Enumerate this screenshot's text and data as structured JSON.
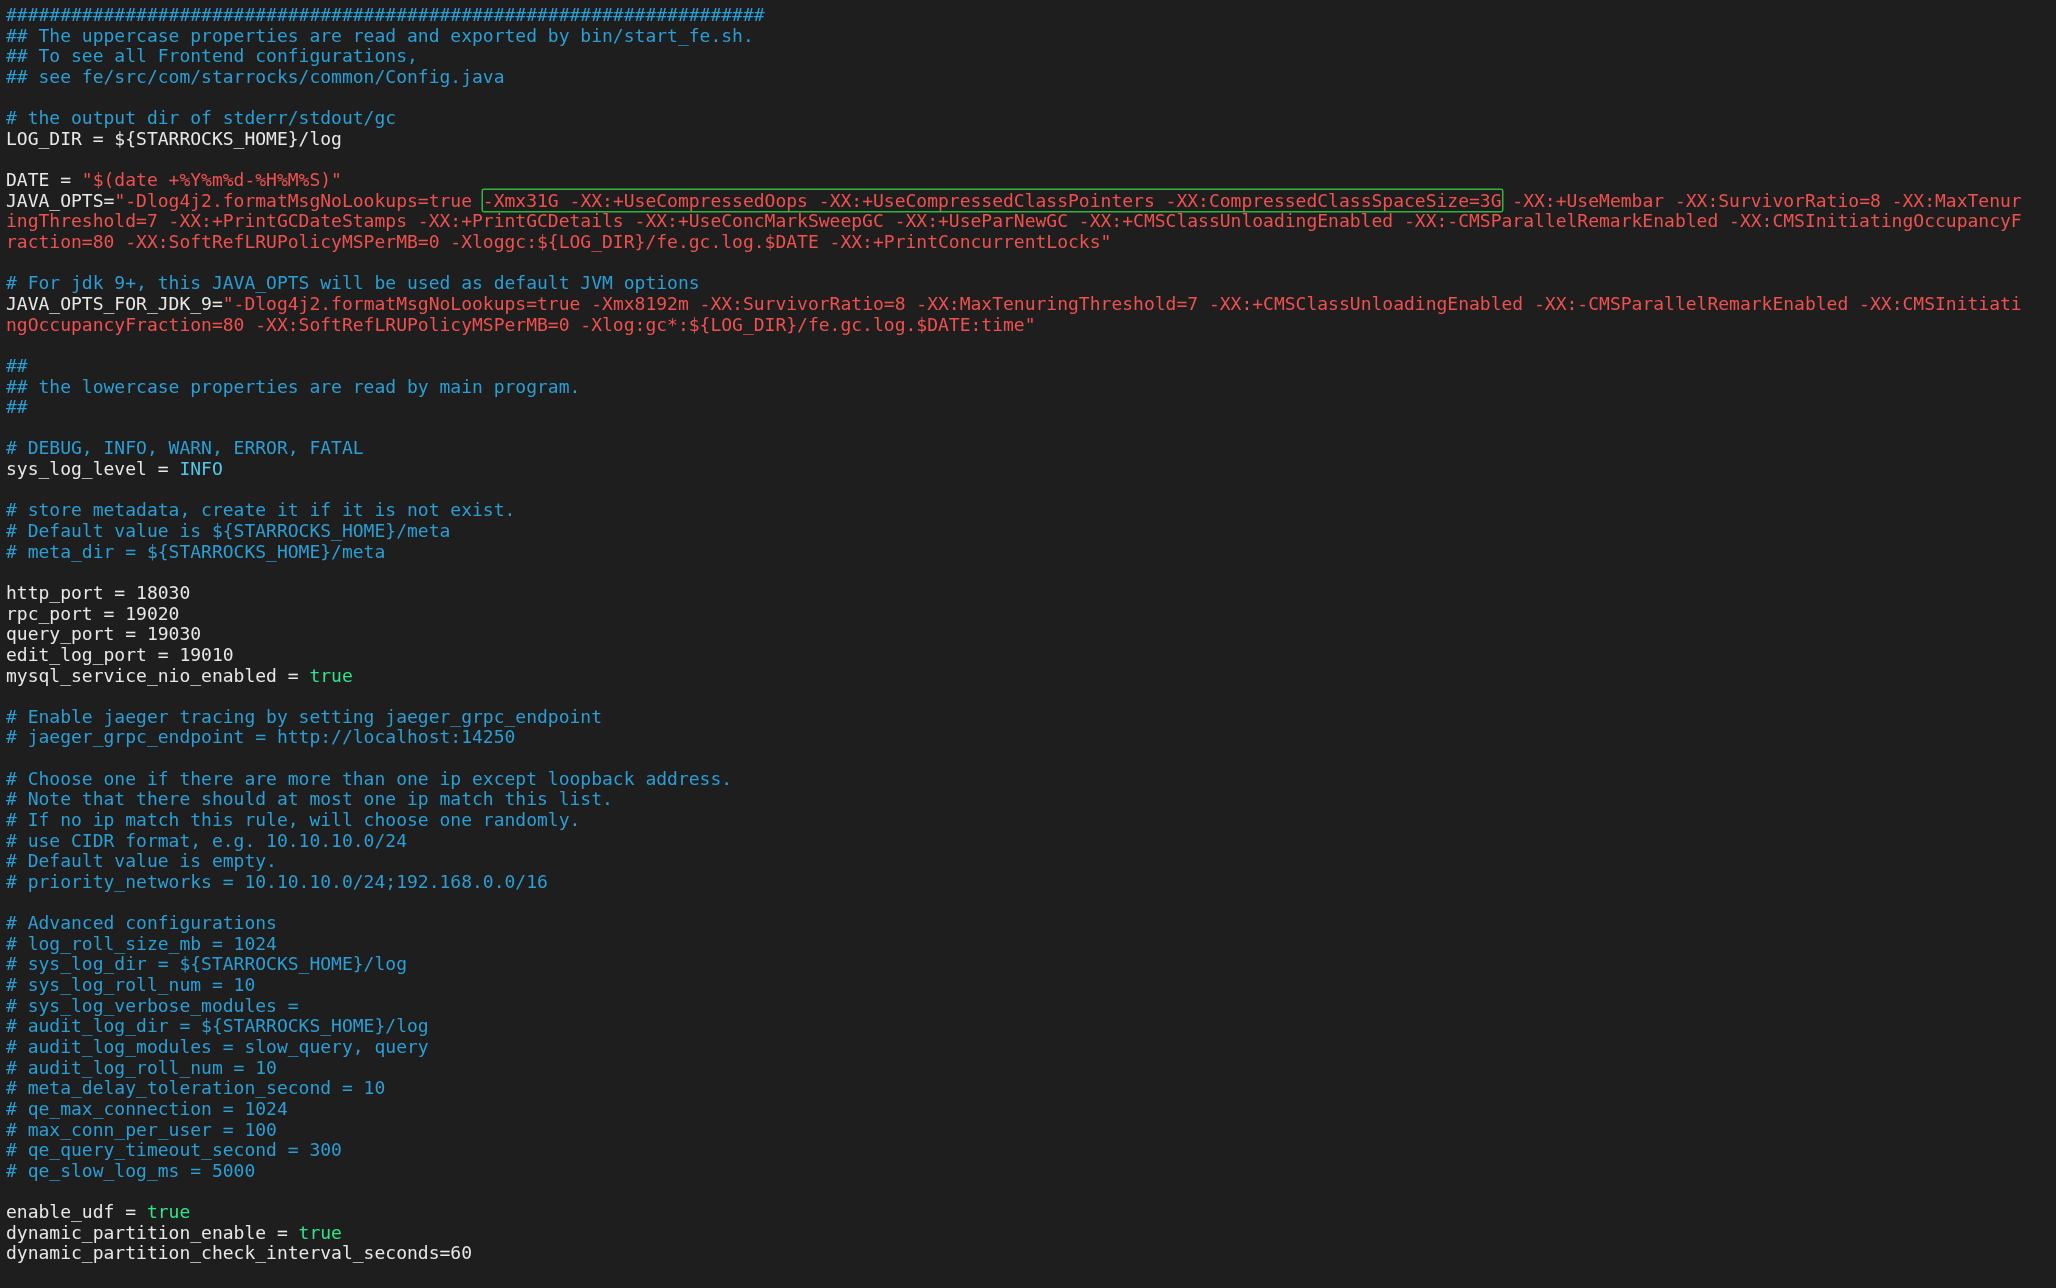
{
  "editor": {
    "lines": [
      {
        "kind": "text",
        "segments": [
          {
            "kind": "comment",
            "text": "######################################################################"
          }
        ]
      },
      {
        "kind": "text",
        "segments": [
          {
            "kind": "comment",
            "text": "## The uppercase properties are read and exported by bin/start_fe.sh."
          }
        ]
      },
      {
        "kind": "text",
        "segments": [
          {
            "kind": "comment",
            "text": "## To see all Frontend configurations,"
          }
        ]
      },
      {
        "kind": "text",
        "segments": [
          {
            "kind": "comment",
            "text": "## see fe/src/com/starrocks/common/Config.java"
          }
        ]
      },
      {
        "kind": "blank"
      },
      {
        "kind": "text",
        "segments": [
          {
            "kind": "comment",
            "text": "# the output dir of stderr/stdout/gc"
          }
        ]
      },
      {
        "kind": "text",
        "segments": [
          {
            "kind": "plain",
            "text": "LOG_DIR = ${STARROCKS_HOME}/log"
          }
        ]
      },
      {
        "kind": "blank"
      },
      {
        "kind": "text",
        "segments": [
          {
            "kind": "plain",
            "text": "DATE = "
          },
          {
            "kind": "string",
            "text": "\"$(date +%Y%m%d-%H%M%S)\""
          }
        ]
      },
      {
        "kind": "text",
        "segments": [
          {
            "kind": "plain",
            "text": "JAVA_OPTS="
          },
          {
            "kind": "string",
            "text": "\"-Dlog4j2.formatMsgNoLookups=true "
          },
          {
            "kind": "string",
            "boxed": true,
            "text": "-Xmx31G -XX:+UseCompressedOops -XX:+UseCompressedClassPointers -XX:CompressedClassSpaceSize=3G"
          },
          {
            "kind": "string",
            "text": " -XX:+UseMembar -XX:SurvivorRatio=8 -XX:MaxTenur"
          }
        ]
      },
      {
        "kind": "text",
        "segments": [
          {
            "kind": "string",
            "text": "ingThreshold=7 -XX:+PrintGCDateStamps -XX:+PrintGCDetails -XX:+UseConcMarkSweepGC -XX:+UseParNewGC -XX:+CMSClassUnloadingEnabled -XX:-CMSParallelRemarkEnabled -XX:CMSInitiatingOccupancyF"
          }
        ]
      },
      {
        "kind": "text",
        "segments": [
          {
            "kind": "string",
            "text": "raction=80 -XX:SoftRefLRUPolicyMSPerMB=0 -Xloggc:${LOG_DIR}/fe.gc.log.$DATE -XX:+PrintConcurrentLocks\""
          }
        ]
      },
      {
        "kind": "blank"
      },
      {
        "kind": "text",
        "segments": [
          {
            "kind": "comment",
            "text": "# For jdk 9+, this JAVA_OPTS will be used as default JVM options"
          }
        ]
      },
      {
        "kind": "text",
        "segments": [
          {
            "kind": "plain",
            "text": "JAVA_OPTS_FOR_JDK_9="
          },
          {
            "kind": "string",
            "text": "\"-Dlog4j2.formatMsgNoLookups=true -Xmx8192m -XX:SurvivorRatio=8 -XX:MaxTenuringThreshold=7 -XX:+CMSClassUnloadingEnabled -XX:-CMSParallelRemarkEnabled -XX:CMSInitiati"
          }
        ]
      },
      {
        "kind": "text",
        "segments": [
          {
            "kind": "string",
            "text": "ngOccupancyFraction=80 -XX:SoftRefLRUPolicyMSPerMB=0 -Xlog:gc*:${LOG_DIR}/fe.gc.log.$DATE:time\""
          }
        ]
      },
      {
        "kind": "blank"
      },
      {
        "kind": "text",
        "segments": [
          {
            "kind": "comment",
            "text": "##"
          }
        ]
      },
      {
        "kind": "text",
        "segments": [
          {
            "kind": "comment",
            "text": "## the lowercase properties are read by main program."
          }
        ]
      },
      {
        "kind": "text",
        "segments": [
          {
            "kind": "comment",
            "text": "##"
          }
        ]
      },
      {
        "kind": "blank"
      },
      {
        "kind": "text",
        "segments": [
          {
            "kind": "comment",
            "text": "# DEBUG, INFO, WARN, ERROR, FATAL"
          }
        ]
      },
      {
        "kind": "text",
        "segments": [
          {
            "kind": "plain",
            "text": "sys_log_level = "
          },
          {
            "kind": "constant",
            "text": "INFO"
          }
        ]
      },
      {
        "kind": "blank"
      },
      {
        "kind": "text",
        "segments": [
          {
            "kind": "comment",
            "text": "# store metadata, create it if it is not exist."
          }
        ]
      },
      {
        "kind": "text",
        "segments": [
          {
            "kind": "comment",
            "text": "# Default value is ${STARROCKS_HOME}/meta"
          }
        ]
      },
      {
        "kind": "text",
        "segments": [
          {
            "kind": "comment",
            "text": "# meta_dir = ${STARROCKS_HOME}/meta"
          }
        ]
      },
      {
        "kind": "blank"
      },
      {
        "kind": "text",
        "segments": [
          {
            "kind": "plain",
            "text": "http_port = 18030"
          }
        ]
      },
      {
        "kind": "text",
        "segments": [
          {
            "kind": "plain",
            "text": "rpc_port = 19020"
          }
        ]
      },
      {
        "kind": "text",
        "segments": [
          {
            "kind": "plain",
            "text": "query_port = 19030"
          }
        ]
      },
      {
        "kind": "text",
        "segments": [
          {
            "kind": "plain",
            "text": "edit_log_port = 19010"
          }
        ]
      },
      {
        "kind": "text",
        "segments": [
          {
            "kind": "plain",
            "text": "mysql_service_nio_enabled = "
          },
          {
            "kind": "boolean",
            "text": "true"
          }
        ]
      },
      {
        "kind": "blank"
      },
      {
        "kind": "text",
        "segments": [
          {
            "kind": "comment",
            "text": "# Enable jaeger tracing by setting jaeger_grpc_endpoint"
          }
        ]
      },
      {
        "kind": "text",
        "segments": [
          {
            "kind": "comment",
            "text": "# jaeger_grpc_endpoint = http://localhost:14250"
          }
        ]
      },
      {
        "kind": "blank"
      },
      {
        "kind": "text",
        "segments": [
          {
            "kind": "comment",
            "text": "# Choose one if there are more than one ip except loopback address."
          }
        ]
      },
      {
        "kind": "text",
        "segments": [
          {
            "kind": "comment",
            "text": "# Note that there should at most one ip match this list."
          }
        ]
      },
      {
        "kind": "text",
        "segments": [
          {
            "kind": "comment",
            "text": "# If no ip match this rule, will choose one randomly."
          }
        ]
      },
      {
        "kind": "text",
        "segments": [
          {
            "kind": "comment",
            "text": "# use CIDR format, e.g. 10.10.10.0/24"
          }
        ]
      },
      {
        "kind": "text",
        "segments": [
          {
            "kind": "comment",
            "text": "# Default value is empty."
          }
        ]
      },
      {
        "kind": "text",
        "segments": [
          {
            "kind": "comment",
            "text": "# priority_networks = 10.10.10.0/24;192.168.0.0/16"
          }
        ]
      },
      {
        "kind": "blank"
      },
      {
        "kind": "text",
        "segments": [
          {
            "kind": "comment",
            "text": "# Advanced configurations"
          }
        ]
      },
      {
        "kind": "text",
        "segments": [
          {
            "kind": "comment",
            "text": "# log_roll_size_mb = 1024"
          }
        ]
      },
      {
        "kind": "text",
        "segments": [
          {
            "kind": "comment",
            "text": "# sys_log_dir = ${STARROCKS_HOME}/log"
          }
        ]
      },
      {
        "kind": "text",
        "segments": [
          {
            "kind": "comment",
            "text": "# sys_log_roll_num = 10"
          }
        ]
      },
      {
        "kind": "text",
        "segments": [
          {
            "kind": "comment",
            "text": "# sys_log_verbose_modules ="
          }
        ]
      },
      {
        "kind": "text",
        "segments": [
          {
            "kind": "comment",
            "text": "# audit_log_dir = ${STARROCKS_HOME}/log"
          }
        ]
      },
      {
        "kind": "text",
        "segments": [
          {
            "kind": "comment",
            "text": "# audit_log_modules = slow_query, query"
          }
        ]
      },
      {
        "kind": "text",
        "segments": [
          {
            "kind": "comment",
            "text": "# audit_log_roll_num = 10"
          }
        ]
      },
      {
        "kind": "text",
        "segments": [
          {
            "kind": "comment",
            "text": "# meta_delay_toleration_second = 10"
          }
        ]
      },
      {
        "kind": "text",
        "segments": [
          {
            "kind": "comment",
            "text": "# qe_max_connection = 1024"
          }
        ]
      },
      {
        "kind": "text",
        "segments": [
          {
            "kind": "comment",
            "text": "# max_conn_per_user = 100"
          }
        ]
      },
      {
        "kind": "text",
        "segments": [
          {
            "kind": "comment",
            "text": "# qe_query_timeout_second = 300"
          }
        ]
      },
      {
        "kind": "text",
        "segments": [
          {
            "kind": "comment",
            "text": "# qe_slow_log_ms = 5000"
          }
        ]
      },
      {
        "kind": "blank"
      },
      {
        "kind": "text",
        "segments": [
          {
            "kind": "plain",
            "text": "enable_udf = "
          },
          {
            "kind": "boolean",
            "text": "true"
          }
        ]
      },
      {
        "kind": "text",
        "segments": [
          {
            "kind": "plain",
            "text": "dynamic_partition_enable = "
          },
          {
            "kind": "boolean",
            "text": "true"
          }
        ]
      },
      {
        "kind": "text",
        "segments": [
          {
            "kind": "plain",
            "text": "dynamic_partition_check_interval_seconds=60"
          }
        ]
      }
    ]
  }
}
